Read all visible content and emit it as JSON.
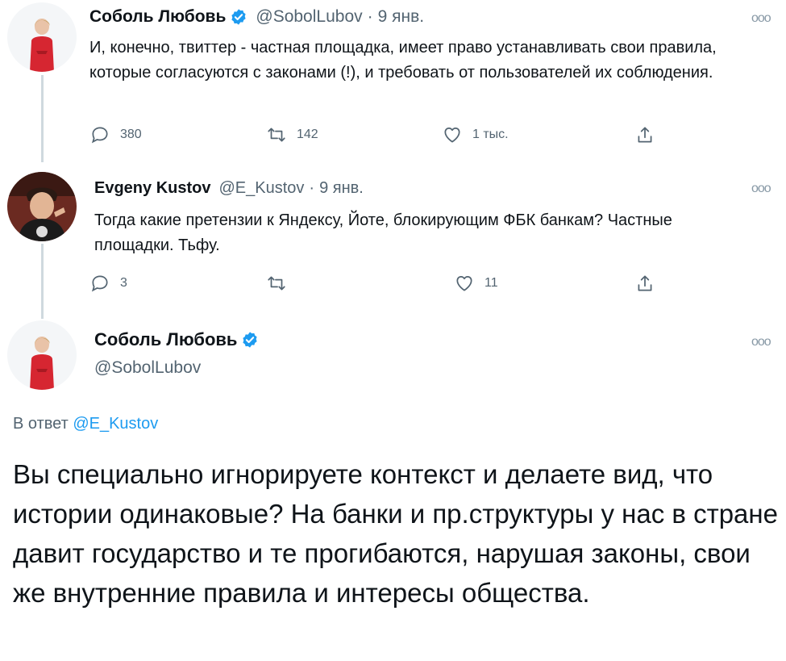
{
  "tweet1": {
    "name": "Соболь Любовь",
    "handle": "@SobolLubov",
    "date": "9 янв.",
    "text": "И, конечно, твиттер - частная площадка, имеет право устанавливать свои правила, которые согласуются с законами (!), и требовать от пользователей их соблюдения.",
    "replies": "380",
    "retweets": "142",
    "likes": "1 тыс.",
    "more": "ooo"
  },
  "tweet2": {
    "name": "Evgeny Kustov",
    "handle": "@E_Kustov",
    "date": "9 янв.",
    "text": "Тогда какие претензии к Яндексу, Йоте, блокирующим ФБК банкам? Частные площадки. Тьфу.",
    "replies": "3",
    "retweets": "",
    "likes": "11",
    "more": "ooo"
  },
  "tweet3": {
    "name": "Соболь Любовь",
    "handle": "@SobolLubov",
    "reply_prefix": "В ответ",
    "reply_handle": "@E_Kustov",
    "text": "Вы специально игнорируете контекст и делаете вид, что истории одинаковые? На банки и пр.структуры у нас в стране давит государство и те прогибаются, нарушая законы, свои же внутренние правила и интересы общества.",
    "more": "ooo"
  },
  "icons": {
    "reply": "reply-icon",
    "retweet": "retweet-icon",
    "like": "heart-icon",
    "share": "share-icon",
    "verified": "verified-badge-icon"
  },
  "colors": {
    "verified": "#1d9bf0",
    "secondary_text": "#536471",
    "thread_line": "#cfd9de",
    "link": "#1d9bf0"
  }
}
